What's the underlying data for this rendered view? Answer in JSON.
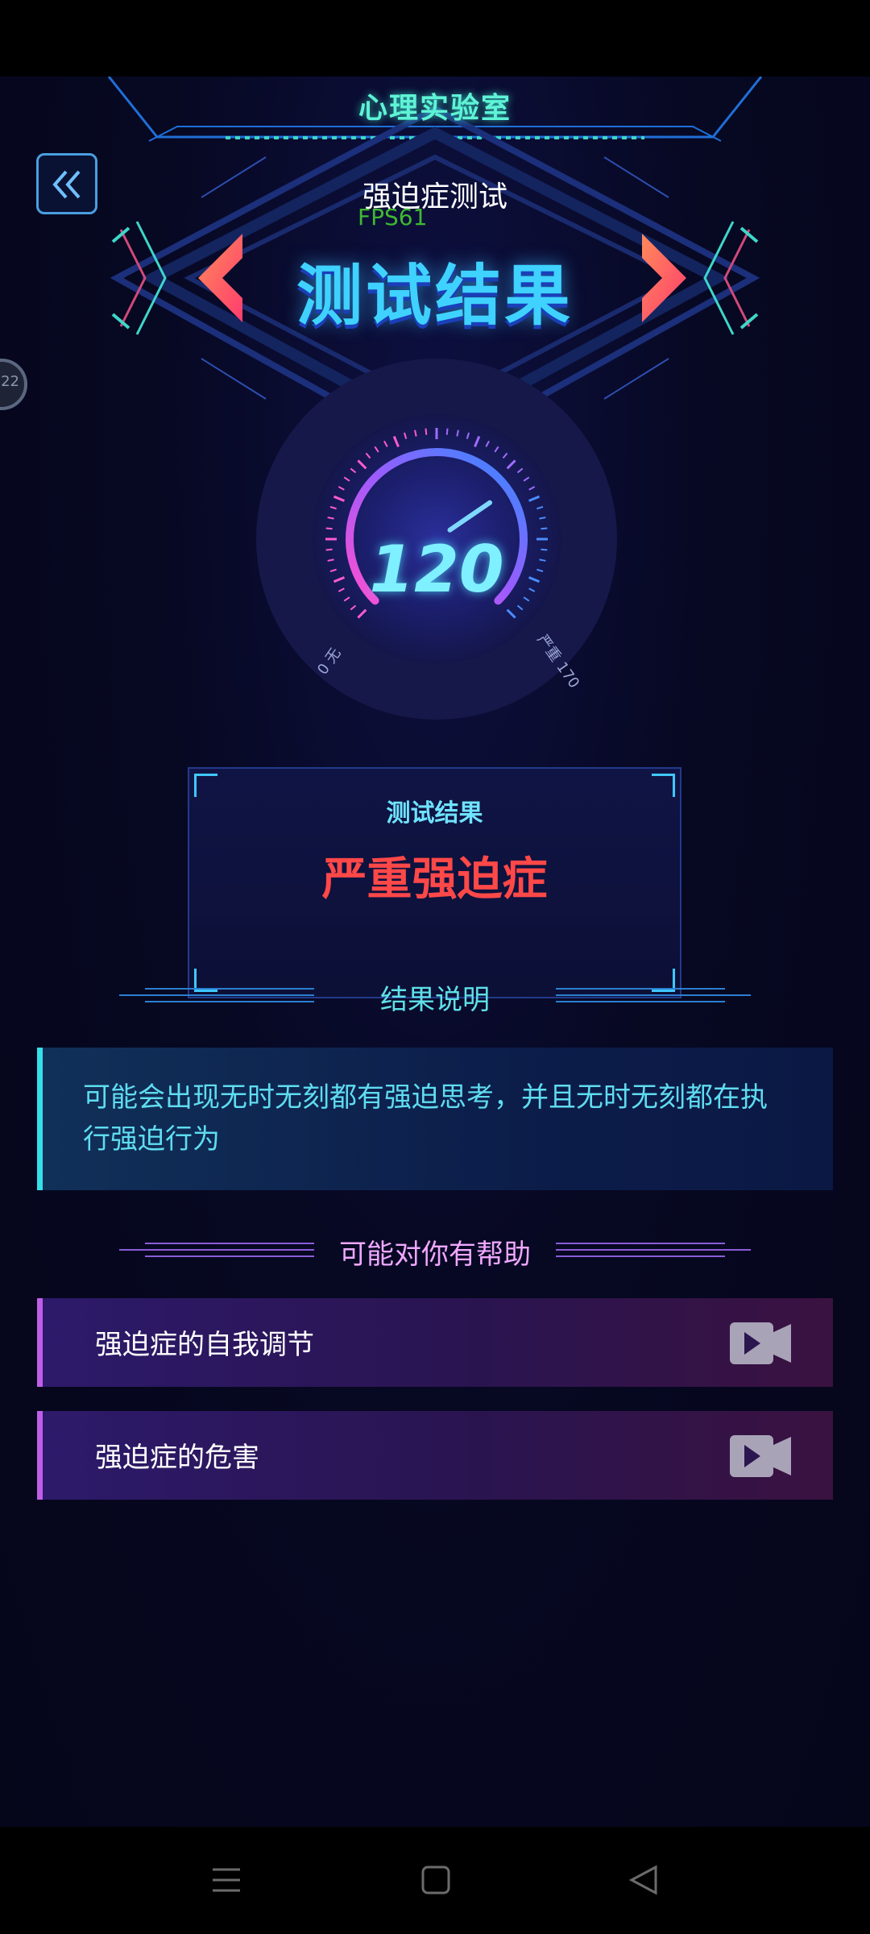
{
  "header": {
    "app_title": "心理实验室",
    "test_name": "强迫症测试",
    "fps": "FPS61",
    "page_title": "测试结果",
    "back_label": "back"
  },
  "float_ball": {
    "label": "22"
  },
  "gauge": {
    "value": "120",
    "min_label": "0 无",
    "max_label": "严重 170",
    "min": 0,
    "max": 170,
    "current": 120
  },
  "result": {
    "label": "测试结果",
    "value": "严重强迫症"
  },
  "explanation": {
    "heading": "结果说明",
    "text": "可能会出现无时无刻都有强迫思考，并且无时无刻都在执行强迫行为"
  },
  "help": {
    "heading": "可能对你有帮助",
    "items": [
      {
        "label": "强迫症的自我调节",
        "icon": "video-icon"
      },
      {
        "label": "强迫症的危害",
        "icon": "video-icon"
      }
    ]
  },
  "nav": {
    "menu_icon": "menu-icon",
    "home_icon": "home-icon",
    "back_icon": "back-triangle-icon"
  },
  "colors": {
    "accent": "#3fd2ff",
    "danger": "#ff4848",
    "teal": "#5ff3d6",
    "purple": "#c05ee8"
  }
}
